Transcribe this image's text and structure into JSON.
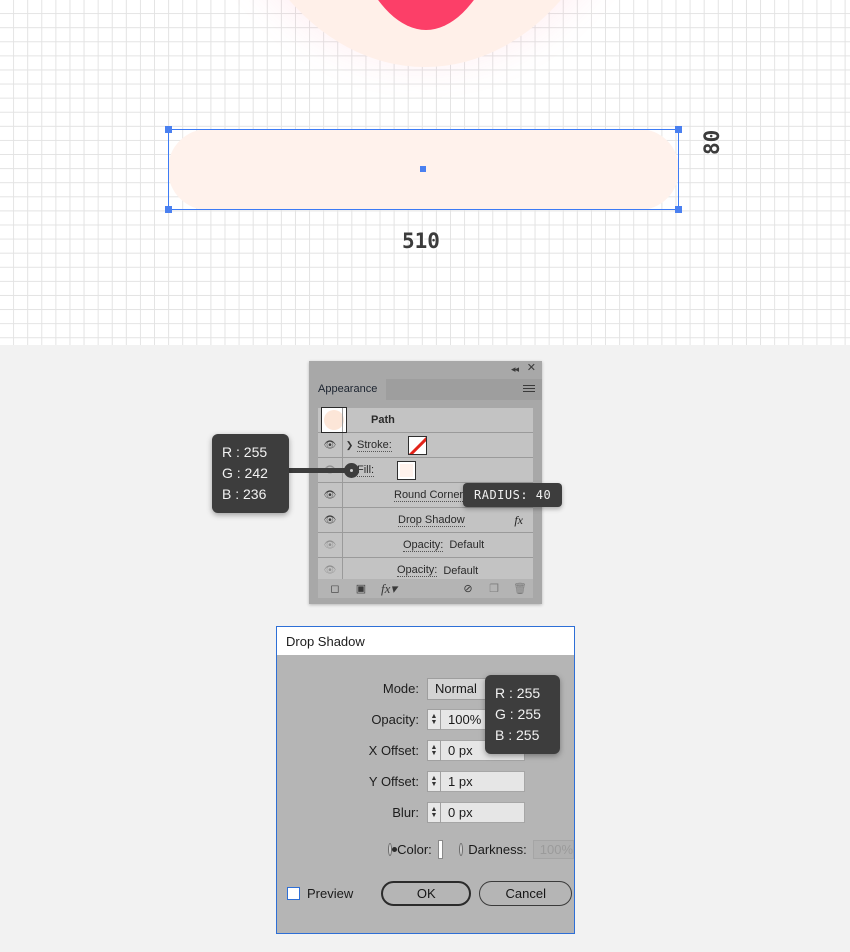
{
  "canvas": {
    "width_label": "510",
    "height_label": "80",
    "shape_fill": "#fff2ec",
    "selection_color": "#3d7bf5"
  },
  "appearance_panel": {
    "tab_label": "Appearance",
    "collapse_icon": "◂◂",
    "close_icon": "✕",
    "menu_icon": "hamburger-icon",
    "rows": [
      {
        "label": "Path",
        "kind": "header"
      },
      {
        "label": "Stroke:",
        "kind": "stroke"
      },
      {
        "label": "Fill:",
        "kind": "fill"
      },
      {
        "label": "Round Corners",
        "kind": "effect"
      },
      {
        "label": "Drop Shadow",
        "kind": "effect",
        "fx": "fx"
      },
      {
        "label": "Opacity:",
        "value": "Default",
        "kind": "opacity"
      },
      {
        "label": "Opacity:",
        "value": "Default",
        "kind": "opacity"
      }
    ],
    "bottom_bar": [
      {
        "name": "add-new-stroke",
        "glyph": "◻"
      },
      {
        "name": "add-new-fill",
        "glyph": "▣"
      },
      {
        "name": "add-new-effect",
        "glyph": "fx▾"
      },
      {
        "name": "clear-appearance",
        "glyph": "⊘"
      },
      {
        "name": "duplicate-item",
        "glyph": "❐"
      },
      {
        "name": "delete-item",
        "glyph": "🗑"
      }
    ]
  },
  "tooltips": {
    "fill_color": {
      "r": "R : 255",
      "g": "G : 242",
      "b": "B : 236"
    },
    "shadow_color": {
      "r": "R : 255",
      "g": "G : 255",
      "b": "B : 255"
    },
    "radius": "RADIUS: 40"
  },
  "drop_shadow_dialog": {
    "title": "Drop Shadow",
    "mode_label": "Mode:",
    "mode_value": "Normal",
    "opacity_label": "Opacity:",
    "opacity_value": "100%",
    "x_offset_label": "X Offset:",
    "x_offset_value": "0 px",
    "y_offset_label": "Y Offset:",
    "y_offset_value": "1 px",
    "blur_label": "Blur:",
    "blur_value": "0 px",
    "color_label": "Color:",
    "darkness_label": "Darkness:",
    "darkness_value": "100%",
    "preview_label": "Preview",
    "ok_label": "OK",
    "cancel_label": "Cancel"
  }
}
